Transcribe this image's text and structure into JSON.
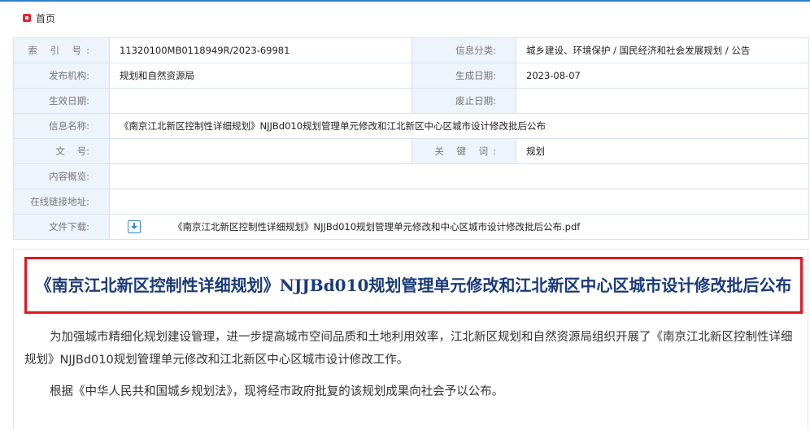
{
  "breadcrumb": {
    "home": "首页"
  },
  "meta": {
    "index_label": "索 引 号:",
    "index_value": "11320100MB0118949R/2023-69981",
    "category_label": "信息分类:",
    "category_value": "城乡建设、环境保护 / 国民经济和社会发展规划 / 公告",
    "publisher_label": "发布机构:",
    "publisher_value": "规划和自然资源局",
    "created_label": "生成日期:",
    "created_value": "2023-08-07",
    "effective_label": "生效日期:",
    "effective_value": "",
    "abolished_label": "废止日期:",
    "abolished_value": "",
    "name_label": "信息名称:",
    "name_value": "《南京江北新区控制性详细规划》NJJBd010规划管理单元修改和江北新区中心区城市设计修改批后公布",
    "docno_label": "文    号:",
    "docno_value": "",
    "keywords_label": "关 键 词:",
    "keywords_value": "规划",
    "summary_label": "内容概览:",
    "summary_value": "",
    "link_label": "在线链接地址:",
    "link_value": "",
    "download_label": "文件下载:",
    "download_file": "《南京江北新区控制性详细规划》NJJBd010规划管理单元修改和中心区城市设计修改批后公布.pdf"
  },
  "article": {
    "title": "《南京江北新区控制性详细规划》NJJBd010规划管理单元修改和江北新区中心区城市设计修改批后公布",
    "paragraphs": [
      "为加强城市精细化规划建设管理，进一步提高城市空间品质和土地利用效率，江北新区规划和自然资源局组织开展了《南京江北新区控制性详细规划》NJJBd010规划管理单元修改和江北新区中心区城市设计修改工作。",
      "根据《中华人民共和国城乡规划法》，现将经市政府批复的该规划成果向社会予以公布。"
    ]
  },
  "colors": {
    "accent_blue": "#2f7fd0",
    "highlight_red": "#e6141f",
    "title_blue": "#1a3a7a",
    "label_bg": "#eef4fb"
  }
}
